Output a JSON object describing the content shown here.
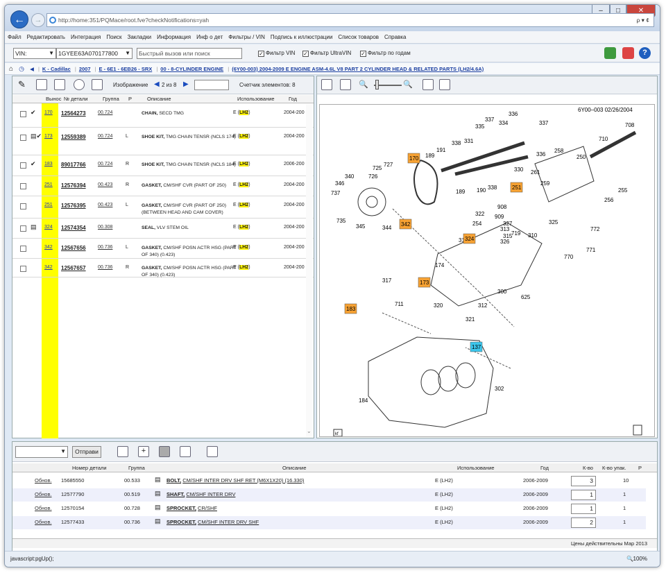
{
  "browser": {
    "url": "http://home:351/PQMace/root.fve?checkNotifications=yah",
    "search_label": "ρ ▾ ¢",
    "status_text": "javascript:pgUp();",
    "zoom": "100%"
  },
  "menu": [
    "Файл",
    "Редактировать",
    "Интеграция",
    "Поиск",
    "Закладки",
    "Информация",
    "Инф о дет",
    "Фильтры / VIN",
    "Подпись к иллюстрации",
    "Список товаров",
    "Справка"
  ],
  "toolbar": {
    "vin_label": "VIN:",
    "vin_value": "1GYEE63A070177800",
    "quick_search_placeholder": "Быстрый вызов или поиск",
    "filter_vin": "Фильтр VIN",
    "filter_ultravin": "Фильтр UltraVIN",
    "filter_years": "Фильтр по годам"
  },
  "breadcrumbs": [
    "K - Cadillac",
    "2007",
    "E - 6E1 - 6EB26 - SRX",
    "00 - 8-CYLINDER ENGINE",
    "(6Y00-003)  2004-2009  E ENGINE ASM-4.6L V8 PART 2 CYLINDER HEAD & RELATED PARTS (LH2/4.6A)"
  ],
  "parts_pane": {
    "image_label": "Изображение",
    "image_pos": "2 из 8",
    "counter_label": "Счетчик элементов: 8",
    "columns": [
      "Вынос",
      "№ детали",
      "Группа",
      "Р",
      "Описание",
      "Использование",
      "Год"
    ],
    "rows": [
      {
        "no": "170",
        "part": "12564273",
        "group": "00.724",
        "lr": "",
        "desc_b": "CHAIN,",
        "desc": "SECD TMG",
        "use": "E",
        "tag": "LH2",
        "year": "2004-200",
        "icon": "✔"
      },
      {
        "no": "173",
        "part": "12559389",
        "group": "00.724",
        "lr": "L",
        "desc_b": "SHOE KIT,",
        "desc": "TMG CHAIN TENSR (NCLS 174)",
        "use": "E",
        "tag": "LH2",
        "year": "2004-200",
        "icon": "▤✔"
      },
      {
        "no": "183",
        "part": "89017766",
        "group": "00.724",
        "lr": "R",
        "desc_b": "SHOE KIT,",
        "desc": "TMG CHAIN TENSR (NCLS 184)",
        "use": "E",
        "tag": "LH2",
        "year": "2006-200",
        "icon": "✔"
      },
      {
        "no": "251",
        "part": "12576394",
        "group": "00.423",
        "lr": "R",
        "desc_b": "GASKET,",
        "desc": "CM/SHF CVR (PART OF 250)",
        "use": "E",
        "tag": "LH2",
        "year": "2004-200",
        "icon": ""
      },
      {
        "no": "251",
        "part": "12576395",
        "group": "00.423",
        "lr": "L",
        "desc_b": "GASKET,",
        "desc": "CM/SHF CVR (PART OF 250) (BETWEEN HEAD AND CAM COVER)",
        "use": "E",
        "tag": "LH2",
        "year": "2004-200",
        "icon": ""
      },
      {
        "no": "324",
        "part": "12574354",
        "group": "00.308",
        "lr": "",
        "desc_b": "SEAL,",
        "desc": "VLV STEM OIL",
        "use": "E",
        "tag": "LH2",
        "year": "2004-200",
        "icon": "▤"
      },
      {
        "no": "342",
        "part": "12567656",
        "group": "00.736",
        "lr": "L",
        "desc_b": "GASKET,",
        "desc": "CM/SHF POSN ACTR HSG (PART OF 340) (0.423)",
        "use": "E",
        "tag": "LH2",
        "year": "2004-200",
        "icon": ""
      },
      {
        "no": "342",
        "part": "12567657",
        "group": "00.736",
        "lr": "R",
        "desc_b": "GASKET,",
        "desc": "CM/SHF POSN ACTR HSG (PART OF 340) (0.423)",
        "use": "E",
        "tag": "LH2",
        "year": "2004-200",
        "icon": ""
      }
    ]
  },
  "diagram": {
    "header": "6Y00–003  02/26/2004",
    "labels": [
      "337",
      "336",
      "335",
      "334",
      "337",
      "708",
      "338",
      "331",
      "191",
      "189",
      "330",
      "336",
      "258",
      "710",
      "250",
      "725",
      "727",
      "726",
      "340",
      "346",
      "737",
      "735",
      "345",
      "344",
      "189",
      "190",
      "338",
      "261",
      "259",
      "255",
      "256",
      "908",
      "322",
      "909",
      "327",
      "254",
      "325",
      "313",
      "315",
      "719",
      "310",
      "772",
      "311",
      "326",
      "771",
      "770",
      "174",
      "317",
      "300",
      "625",
      "711",
      "320",
      "312",
      "321",
      "184",
      "302"
    ],
    "highlights": [
      "170",
      "251",
      "342",
      "324",
      "173",
      "183",
      "137"
    ],
    "footer_tag": "kf"
  },
  "bottom": {
    "send_label": "Отправи",
    "columns": [
      "Номер детали",
      "Группа",
      "Описание",
      "Использование",
      "Год",
      "К-во",
      "К-во упак.",
      "Р"
    ],
    "rows": [
      {
        "act": "Обнов.",
        "part": "15685550",
        "group": "00.533",
        "name": "BOLT,",
        "desc": "CM/SHF INTER DRV SHF RET (M6X1X20) (16.330)",
        "use": "E (LH2)",
        "year": "2006-2009",
        "qty": "3",
        "pack": "10"
      },
      {
        "act": "Обнов.",
        "part": "12577790",
        "group": "00.519",
        "name": "SHAFT,",
        "desc": "CM/SHF INTER DRV",
        "use": "E (LH2)",
        "year": "2006-2009",
        "qty": "1",
        "pack": "1"
      },
      {
        "act": "Обнов.",
        "part": "12570154",
        "group": "00.728",
        "name": "SPROCKET,",
        "desc": "CR/SHF",
        "use": "E (LH2)",
        "year": "2006-2009",
        "qty": "1",
        "pack": "1"
      },
      {
        "act": "Обнов.",
        "part": "12577433",
        "group": "00.736",
        "name": "SPROCKET,",
        "desc": "CM/SHF INTER DRV SHF",
        "use": "E (LH2)",
        "year": "2006-2009",
        "qty": "2",
        "pack": "1"
      }
    ],
    "price_note": "Цены действительны Мар 2013"
  }
}
